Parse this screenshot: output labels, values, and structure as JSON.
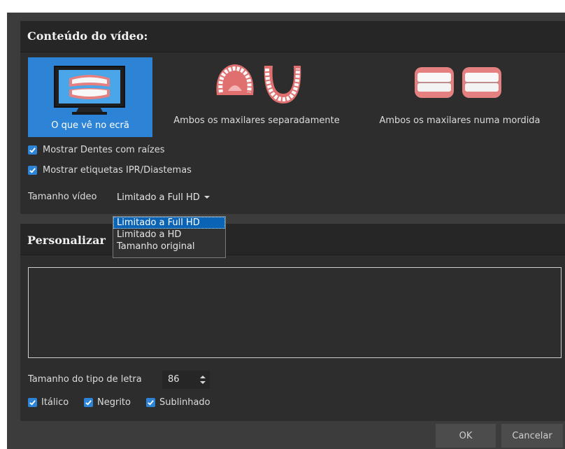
{
  "content_section": {
    "title": "Conteúdo do vídeo:",
    "options": [
      {
        "label": "O que vê no ecrã",
        "selected": true,
        "icon": "monitor-jaws-icon"
      },
      {
        "label": "Ambos os maxilares separadamente",
        "selected": false,
        "icon": "separate-jaws-icon"
      },
      {
        "label": "Ambos os maxilares numa mordida",
        "selected": false,
        "icon": "bite-jaws-icon"
      }
    ],
    "checkboxes": [
      {
        "label": "Mostrar Dentes com raízes",
        "checked": true
      },
      {
        "label": "Mostrar etiquetas IPR/Diastemas",
        "checked": true
      }
    ],
    "video_size": {
      "label": "Tamanho vídeo",
      "value": "Limitado a Full HD",
      "options": [
        "Limitado a Full HD",
        "Limitado a HD",
        "Tamanho original"
      ]
    }
  },
  "custom_section": {
    "title": "Personalizar",
    "font_size": {
      "label": "Tamanho do tipo de letra",
      "value": "86"
    },
    "styles": [
      {
        "label": "Itálico",
        "checked": true
      },
      {
        "label": "Negrito",
        "checked": true
      },
      {
        "label": "Sublinhado",
        "checked": true
      }
    ]
  },
  "buttons": {
    "ok": "OK",
    "cancel": "Cancelar"
  },
  "colors": {
    "accent": "#2d84d6",
    "dropdown_highlight": "#0a63b4",
    "panel": "#2d2d2d",
    "header": "#262626",
    "window": "#3c3c3c"
  }
}
